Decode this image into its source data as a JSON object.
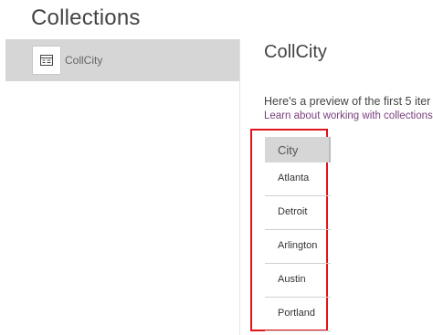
{
  "page": {
    "title": "Collections"
  },
  "sidebar": {
    "items": [
      {
        "label": "CollCity",
        "icon": "table-icon"
      }
    ]
  },
  "detail": {
    "title": "CollCity",
    "preview_text": "Here's a preview of the first 5 iter",
    "learn_link": "Learn about working with collections",
    "table": {
      "columns": [
        "City"
      ],
      "rows": [
        "Atlanta",
        "Detroit",
        "Arlington",
        "Austin",
        "Portland"
      ]
    }
  },
  "colors": {
    "selected_bg": "#d6d6d6",
    "link": "#7a3e7e",
    "highlight_border": "#e0151b"
  }
}
